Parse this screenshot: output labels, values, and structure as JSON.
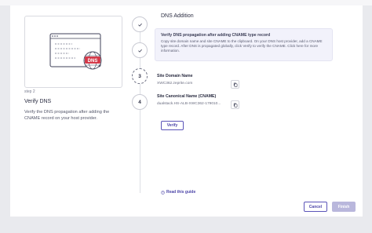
{
  "left": {
    "step_label": "step 2",
    "title": "Verify DNS",
    "description": "Verify the DNS propagation after adding the CNAME record on your host provider.",
    "illustration_badge": "DNS"
  },
  "steps": [
    {
      "state": "done",
      "label": ""
    },
    {
      "state": "done",
      "label": ""
    },
    {
      "state": "current",
      "label": "3"
    },
    {
      "state": "pending",
      "label": "4"
    }
  ],
  "main": {
    "section_title": "DNS Addition",
    "info": {
      "title": "Verify DNS propagation after adding CNAME type record",
      "text": "Copy site domain name and site CNAME to the clipboard. On your DNS host provider, add a CNAME type record. After DNS is propagated globally, click Verify to verify the CNAME. Click here for more information."
    },
    "site_domain": {
      "label": "Site Domain Name",
      "value": "XWC362.zeprite.com"
    },
    "site_cname": {
      "label": "Site Canonical Name (CNAME)",
      "value": "dualstack.HS-ALB-XWC362-179010..."
    },
    "verify_label": "Verify",
    "guide_label": "Read this guide"
  },
  "footer": {
    "cancel_label": "Cancel",
    "finish_label": "Finish"
  },
  "colors": {
    "accent": "#4c45a8",
    "badge": "#d43a4a",
    "finish_disabled": "#b9b7dc"
  },
  "icons": [
    "check-icon",
    "copy-icon",
    "help-circle-icon"
  ]
}
